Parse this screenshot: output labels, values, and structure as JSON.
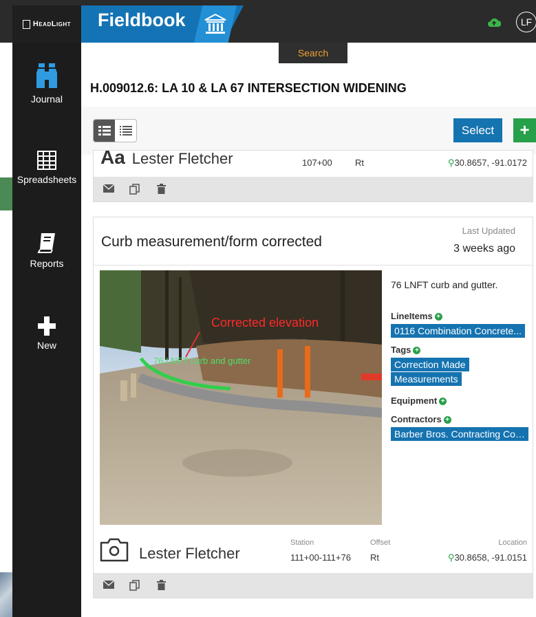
{
  "header": {
    "brand": "HeadLight",
    "app_title": "Fieldbook",
    "avatar_initials": "LF"
  },
  "sidebar": {
    "items": [
      {
        "label": "Journal",
        "icon": "binoculars-icon"
      },
      {
        "label": "Spreadsheets",
        "icon": "grid-icon"
      },
      {
        "label": "Reports",
        "icon": "book-icon"
      },
      {
        "label": "New",
        "icon": "plus-icon"
      }
    ]
  },
  "search_label": "Search",
  "project_title": "H.009012.6: LA 10 & LA 67 INTERSECTION WIDENING",
  "toolbar": {
    "select_label": "Select",
    "add_label": "+"
  },
  "entries": [
    {
      "author_prefix": "Aa",
      "author": "Lester Fletcher",
      "station": "107+00",
      "offset": "Rt",
      "location": "30.8657, -91.0172"
    },
    {
      "title": "Curb measurement/form corrected",
      "last_updated_label": "Last Updated",
      "last_updated": "3 weeks ago",
      "photo_annotations": {
        "red": "Corrected elevation",
        "green": "76 LNFT curb and gutter"
      },
      "description": "76 LNFT curb and gutter.",
      "lineitems_label": "LineItems",
      "lineitems": [
        "0116 Combination Concrete..."
      ],
      "tags_label": "Tags",
      "tags": [
        "Correction Made",
        "Measurements"
      ],
      "equipment_label": "Equipment",
      "contractors_label": "Contractors",
      "contractors": [
        "Barber Bros. Contracting Co...."
      ],
      "station_label": "Station",
      "offset_label": "Offset",
      "location_label": "Location",
      "author": "Lester Fletcher",
      "station": "111+00-111+76",
      "offset": "Rt",
      "location": "30.8658, -91.0151"
    }
  ],
  "colors": {
    "primary": "#1573b0",
    "accent_green": "#27a04a",
    "sidebar": "#1c1c1c",
    "search_text": "#f0a030"
  }
}
